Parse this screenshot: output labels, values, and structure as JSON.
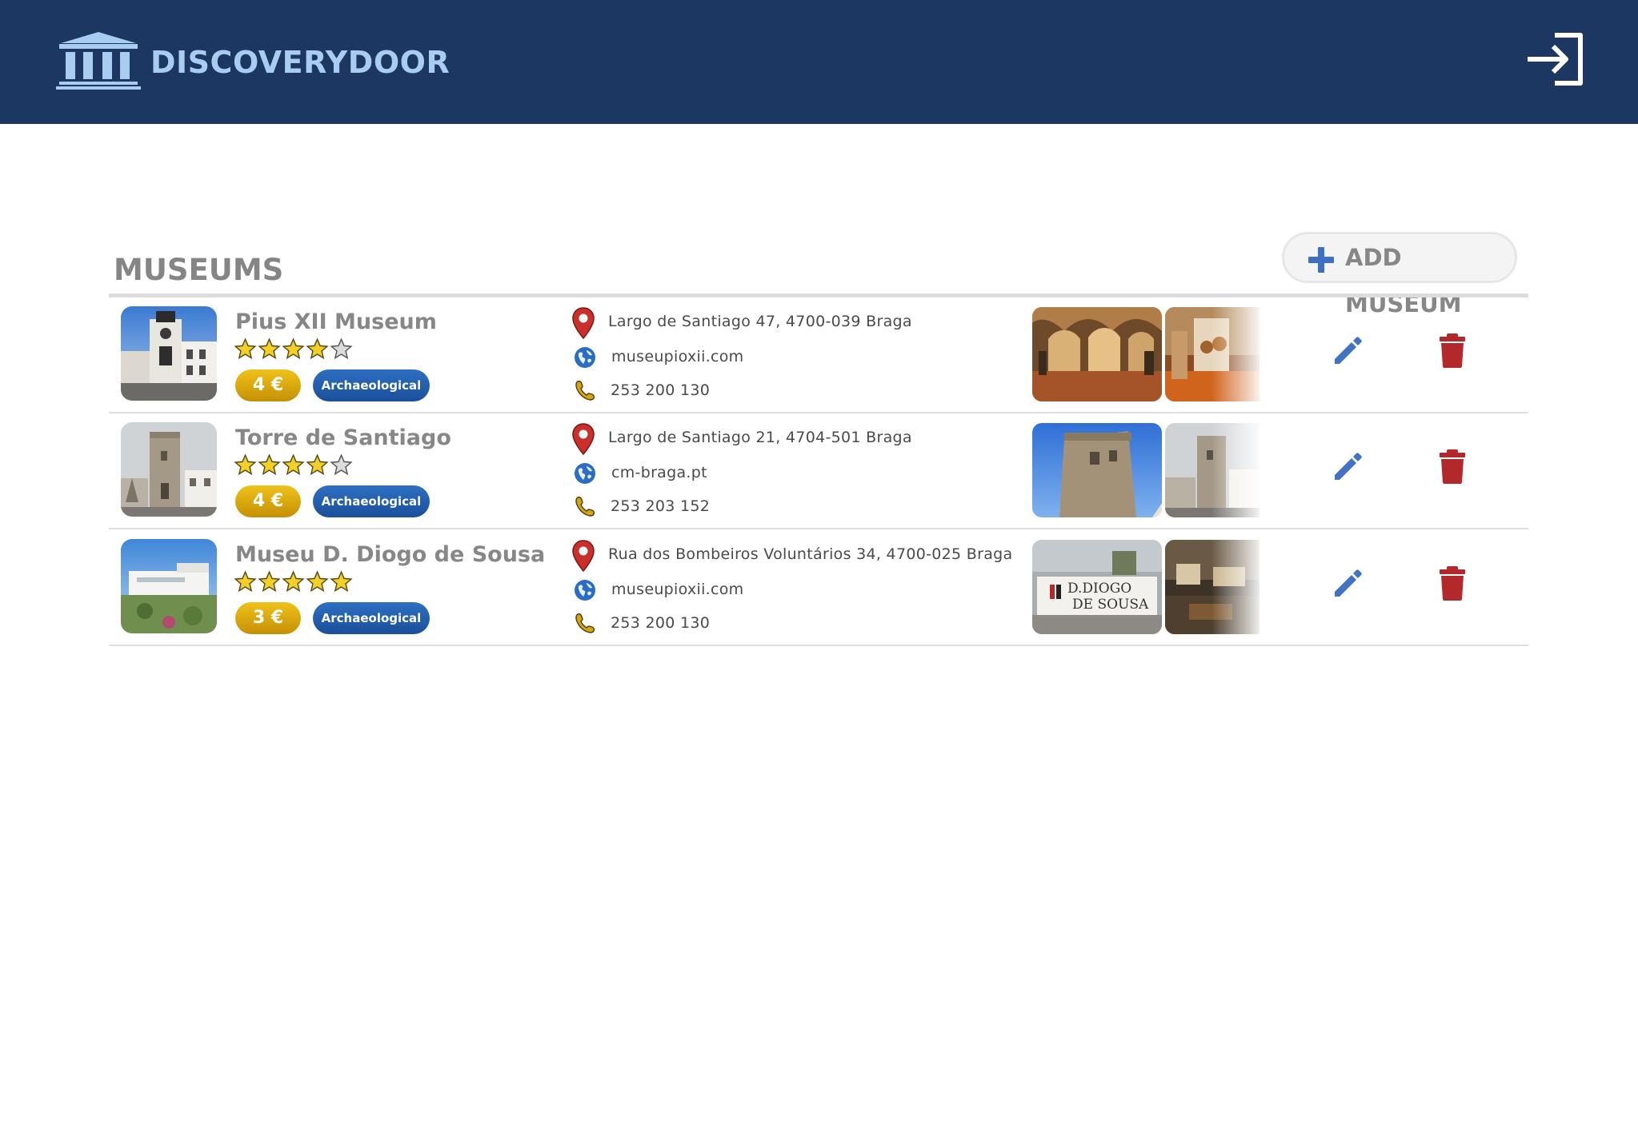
{
  "header": {
    "brand": "DISCOVERYDOOR",
    "logo_icon": "museum-building-icon",
    "login_icon": "sign-in-icon"
  },
  "main": {
    "title": "MUSEUMS",
    "add_button": {
      "label": "ADD MUSEUM",
      "icon": "plus-icon"
    }
  },
  "colors": {
    "header_bg": "#1b3762",
    "brand": "#a9cdf0",
    "price_badge": "#e0aa0c",
    "category_badge": "#2460b0",
    "edit_icon": "#4272c4",
    "delete_icon": "#b2282b",
    "pin_icon": "#c9302c",
    "globe_icon": "#2b6cc4",
    "phone_icon": "#c79a0f"
  },
  "museums": [
    {
      "name": "Pius XII Museum",
      "rating": 4,
      "rating_max": 5,
      "price": "4 €",
      "category": "Archaeological",
      "address": "Largo de Santiago 47, 4700-039 Braga",
      "website": "museupioxii.com",
      "phone": "253 200 130"
    },
    {
      "name": "Torre de Santiago",
      "rating": 4,
      "rating_max": 5,
      "price": "4 €",
      "category": "Archaeological",
      "address": "Largo de Santiago 21,  4704-501 Braga",
      "website": "cm-braga.pt",
      "phone": "253 203 152"
    },
    {
      "name": "Museu D. Diogo de Sousa",
      "rating": 5,
      "rating_max": 5,
      "price": "3 €",
      "category": "Archaeological",
      "address": "Rua dos Bombeiros Voluntários 34, 4700-025 Braga",
      "website": "museupioxii.com",
      "phone": "253 200 130",
      "gallery_sign": [
        "D.DIOGO",
        "DE SOUSA"
      ]
    }
  ]
}
